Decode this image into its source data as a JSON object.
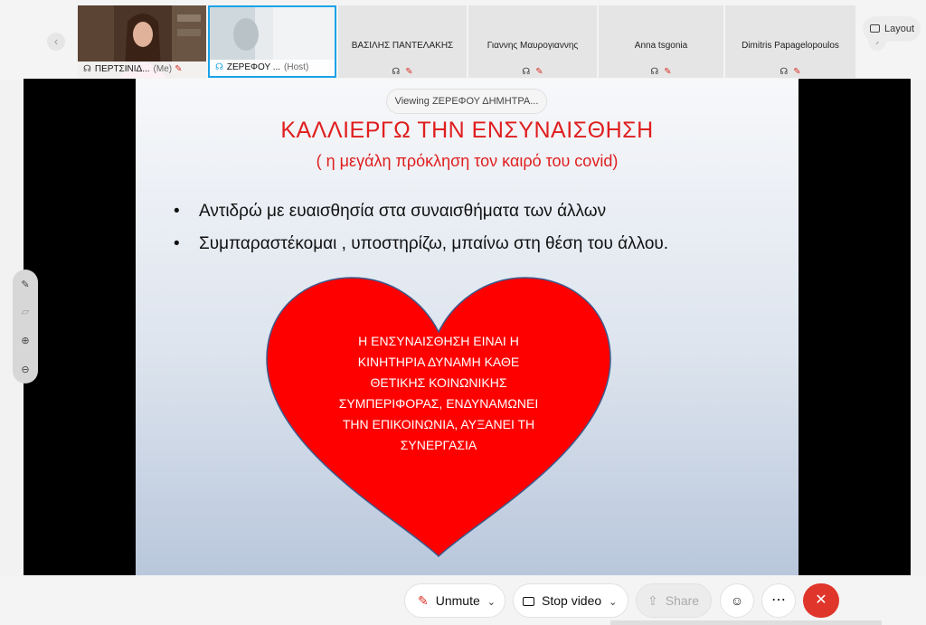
{
  "participants": {
    "me": {
      "name": "ΠΕΡΤΣΙΝΙΔ...",
      "role": "(Me)"
    },
    "host": {
      "name": "ΖΕΡΕΦΟΥ ...",
      "role": "(Host)"
    },
    "others": [
      {
        "name": "ΒΑΣΙΛΗΣ ΠΑΝΤΕΛΑΚΗΣ"
      },
      {
        "name": "Γιαννης Μαυρογιαννης"
      },
      {
        "name": "Anna tsgonia"
      },
      {
        "name": "Dimitris Papagelopoulos"
      }
    ]
  },
  "layout_label": "Layout",
  "viewing_label": "Viewing ΖΕΡΕΦΟΥ ΔΗΜΗΤΡΑ...",
  "slide": {
    "title": "ΚΑΛΛΙΕΡΓΩ  ΤΗΝ  ΕΝΣΥΝΑΙΣΘΗΣΗ",
    "subtitle": "( η μεγάλη πρόκληση τον καιρό του covid)",
    "bullets": [
      "Αντιδρώ με ευαισθησία στα συναισθήματα των άλλων",
      "Συμπαραστέκομαι , υποστηρίζω, μπαίνω στη θέση του άλλου."
    ],
    "heart_text": "Η ΕΝΣΥΝΑΙΣΘΗΣΗ ΕΙΝΑΙ Η ΚΙΝΗΤΗΡΙΑ ΔΥΝΑΜΗ ΚΑΘΕ ΘΕΤΙΚΗΣ  ΚΟΙΝΩΝΙΚΗΣ ΣΥΜΠΕΡΙΦΟΡΑΣ, ΕΝΔΥΝΑΜΩΝΕΙ ΤΗΝ ΕΠΙΚΟΙΝΩΝΙΑ, ΑΥΞΑΝΕΙ ΤΗ ΣΥΝΕΡΓΑΣΙΑ",
    "heart_color": "#ff0000",
    "title_color": "#e01e1e"
  },
  "controls": {
    "unmute": "Unmute",
    "stop_video": "Stop video",
    "share": "Share"
  },
  "colors": {
    "accent": "#1aa3e8",
    "leave": "#e0352b",
    "muted": "#d93025"
  }
}
